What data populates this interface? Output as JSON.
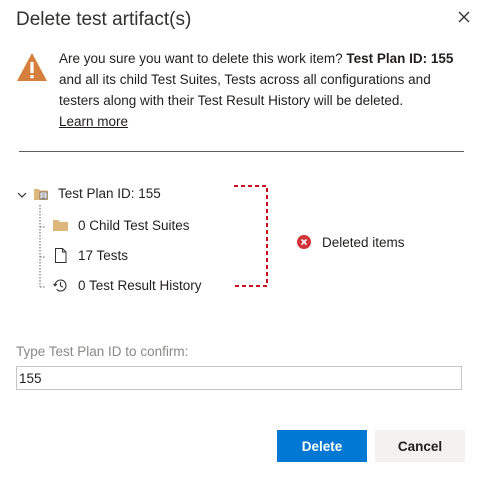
{
  "dialog": {
    "title": "Delete test artifact(s)"
  },
  "warning": {
    "text_before": "Are you sure you want to delete this work item? ",
    "emphasis": "Test Plan ID: 155",
    "text_after": " and all its child Test Suites, Tests across all configurations and testers along with their Test Result History will be deleted.",
    "learn_more": "Learn more",
    "color": "#d67f3c"
  },
  "tree": {
    "root_label": "Test Plan ID: 155",
    "children": [
      {
        "label": "0 Child Test Suites",
        "icon": "folder-icon"
      },
      {
        "label": "17 Tests",
        "icon": "document-icon"
      },
      {
        "label": "0 Test Result History",
        "icon": "history-icon"
      }
    ]
  },
  "legend": {
    "label": "Deleted items",
    "icon": "error-circle-icon",
    "color": "#d13438"
  },
  "confirm": {
    "label": "Type Test Plan ID to confirm:",
    "value": "155"
  },
  "buttons": {
    "delete_label": "Delete",
    "cancel_label": "Cancel",
    "primary_color": "#0078d4"
  }
}
